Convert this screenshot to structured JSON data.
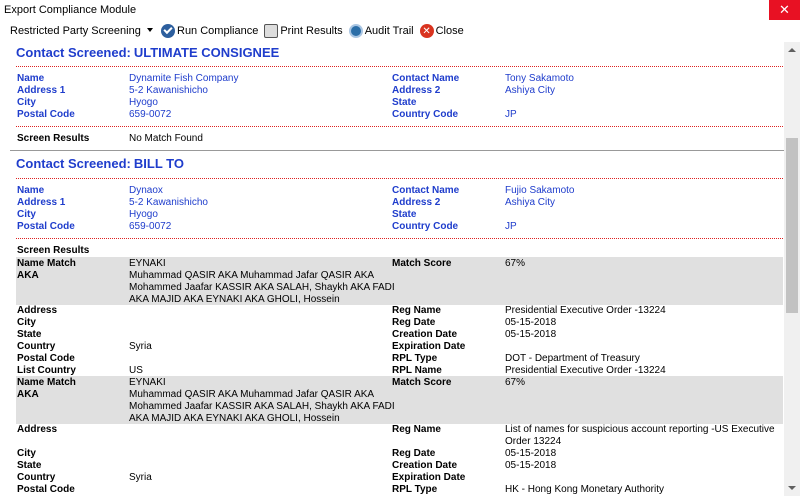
{
  "window": {
    "title": "Export Compliance Module",
    "close_glyph": "✕"
  },
  "toolbar": {
    "dropdown_value": "Restricted Party Screening",
    "run_label": "Run Compliance",
    "print_label": "Print Results",
    "audit_label": "Audit Trail",
    "close_label": "Close"
  },
  "section1": {
    "heading_label": "Contact Screened:",
    "heading_value": "ULTIMATE CONSIGNEE",
    "rows": [
      {
        "l1": "Name",
        "v1": "Dynamite Fish Company",
        "l2": "Contact Name",
        "v2": "Tony Sakamoto"
      },
      {
        "l1": "Address 1",
        "v1": "5-2 Kawanishicho",
        "l2": "Address 2",
        "v2": "Ashiya City"
      },
      {
        "l1": "City",
        "v1": "Hyogo",
        "l2": "State",
        "v2": ""
      },
      {
        "l1": "Postal Code",
        "v1": "659-0072",
        "l2": "Country Code",
        "v2": "JP"
      }
    ],
    "results_label": "Screen Results",
    "results_value": "No Match Found"
  },
  "section2": {
    "heading_label": "Contact Screened:",
    "heading_value": "BILL TO",
    "rows": [
      {
        "l1": "Name",
        "v1": "Dynaox",
        "l2": "Contact Name",
        "v2": "Fujio Sakamoto"
      },
      {
        "l1": "Address 1",
        "v1": "5-2 Kawanishicho",
        "l2": "Address 2",
        "v2": "Ashiya City"
      },
      {
        "l1": "City",
        "v1": "Hyogo",
        "l2": "State",
        "v2": ""
      },
      {
        "l1": "Postal Code",
        "v1": "659-0072",
        "l2": "Country Code",
        "v2": "JP"
      }
    ],
    "results_label": "Screen Results"
  },
  "match1": {
    "name_match_label": "Name Match",
    "name_match_value": "EYNAKI",
    "score_label": "Match Score",
    "score_value": "67%",
    "aka_label": "AKA",
    "aka_lines": [
      "Muhammad QASIR AKA Muhammad Jafar QASIR AKA",
      "Mohammed Jaafar KASSIR AKA SALAH, Shaykh AKA FADI",
      "AKA MAJID AKA EYNAKI AKA GHOLI, Hossein"
    ],
    "details": [
      {
        "l1": "Address",
        "v1": "",
        "l2": "Reg Name",
        "v2": "Presidential Executive Order -13224"
      },
      {
        "l1": "City",
        "v1": "",
        "l2": "Reg Date",
        "v2": "05-15-2018"
      },
      {
        "l1": "State",
        "v1": "",
        "l2": "Creation Date",
        "v2": "05-15-2018"
      },
      {
        "l1": "Country",
        "v1": "Syria",
        "l2": "Expiration Date",
        "v2": ""
      },
      {
        "l1": "Postal Code",
        "v1": "",
        "l2": "RPL Type",
        "v2": "DOT - Department of Treasury"
      },
      {
        "l1": "List Country",
        "v1": "US",
        "l2": "RPL Name",
        "v2": "Presidential Executive Order -13224"
      }
    ]
  },
  "match2": {
    "name_match_label": "Name Match",
    "name_match_value": "EYNAKI",
    "score_label": "Match Score",
    "score_value": "67%",
    "aka_label": "AKA",
    "aka_lines": [
      "Muhammad QASIR AKA Muhammad Jafar QASIR AKA",
      "Mohammed Jaafar KASSIR AKA SALAH, Shaykh AKA FADI",
      "AKA MAJID AKA EYNAKI AKA GHOLI, Hossein"
    ],
    "address_label": "Address",
    "reg_name_label": "Reg Name",
    "reg_name_lines": [
      "List of names for suspicious account reporting -US Executive",
      "Order 13224"
    ],
    "details": [
      {
        "l1": "City",
        "v1": "",
        "l2": "Reg Date",
        "v2": "05-15-2018"
      },
      {
        "l1": "State",
        "v1": "",
        "l2": "Creation Date",
        "v2": "05-15-2018"
      },
      {
        "l1": "Country",
        "v1": "Syria",
        "l2": "Expiration Date",
        "v2": ""
      },
      {
        "l1": "Postal Code",
        "v1": "",
        "l2": "RPL Type",
        "v2": "HK - Hong Kong Monetary Authority"
      }
    ]
  }
}
